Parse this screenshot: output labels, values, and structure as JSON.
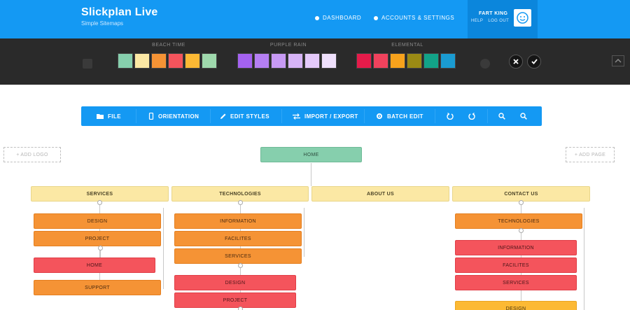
{
  "app": {
    "title": "Slickplan Live",
    "subtitle": "Simple Sitemaps"
  },
  "nav": {
    "dashboard": "DASHBOARD",
    "accounts": "ACCOUNTS & SETTINGS"
  },
  "user": {
    "name": "FART KING",
    "help": "HELP",
    "logout": "LOG OUT"
  },
  "palettes": [
    {
      "name": "BEACH TIME",
      "colors": [
        "#86cfad",
        "#fbe8a4",
        "#f59335",
        "#f4545c",
        "#fcb934",
        "#9fd9ad"
      ]
    },
    {
      "name": "PURPLE RAIN",
      "colors": [
        "#a462f0",
        "#b57ff3",
        "#c89af5",
        "#d7b4f7",
        "#e4c9fa",
        "#efe0fc"
      ]
    },
    {
      "name": "ELEMENTAL",
      "colors": [
        "#e51b4a",
        "#f0425d",
        "#f7a21c",
        "#9a8a14",
        "#12a388",
        "#1a9bd1"
      ]
    }
  ],
  "toolbar": {
    "file": "FILE",
    "orientation": "ORIENTATION",
    "edit_styles": "EDIT STYLES",
    "import_export": "IMPORT / EXPORT",
    "batch_edit": "BATCH EDIT"
  },
  "canvas": {
    "add_logo": "+ ADD LOGO",
    "add_page": "+ ADD PAGE"
  },
  "sitemap": {
    "root": "HOME",
    "services": {
      "label": "SERVICES",
      "children": [
        "DESIGN",
        "PROJECT"
      ],
      "project_children": [
        "HOME"
      ],
      "after": [
        "SUPPORT"
      ]
    },
    "technologies": {
      "label": "TECHNOLOGIES",
      "children": [
        "INFORMATION",
        "FACILITES",
        "SERVICES"
      ],
      "services_children": [
        "DESIGN",
        "PROJECT"
      ]
    },
    "about": {
      "label": "ABOUT US"
    },
    "contact": {
      "label": "CONTACT US",
      "children": [
        "TECHNOLOGIES"
      ],
      "tech_children": [
        "INFORMATION",
        "FACILITES",
        "SERVICES"
      ],
      "after": [
        "DESIGN"
      ]
    }
  }
}
